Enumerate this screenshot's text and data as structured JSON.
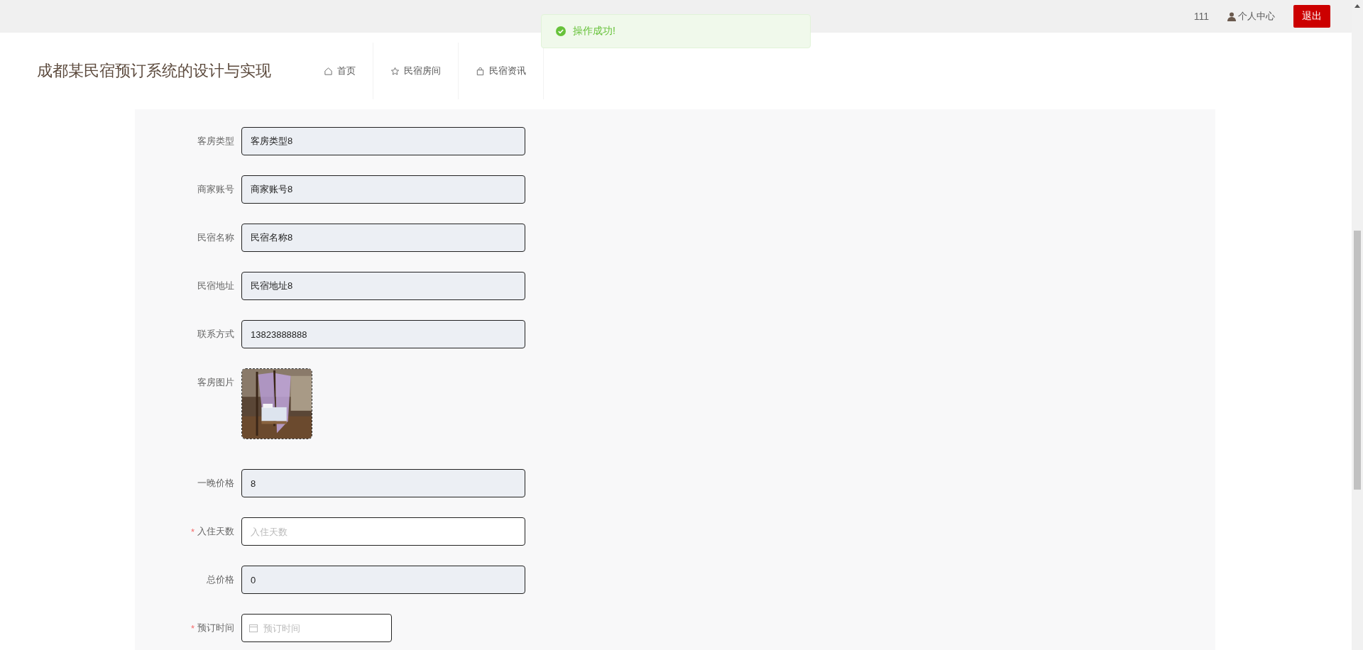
{
  "top_bar": {
    "username": "111",
    "profile_link": "个人中心",
    "logout_button": "退出"
  },
  "toast": {
    "message": "操作成功!"
  },
  "header": {
    "title": "成都某民宿预订系统的设计与实现",
    "nav": [
      {
        "label": "首页",
        "selected": false
      },
      {
        "label": "民宿房间",
        "selected": false
      },
      {
        "label": "民宿资讯",
        "selected": false
      }
    ]
  },
  "form": {
    "fields": [
      {
        "kind": "text",
        "label": "客房类型",
        "value": "客房类型8",
        "readonly": true
      },
      {
        "kind": "text",
        "label": "商家账号",
        "value": "商家账号8",
        "readonly": true
      },
      {
        "kind": "text",
        "label": "民宿名称",
        "value": "民宿名称8",
        "readonly": true
      },
      {
        "kind": "text",
        "label": "民宿地址",
        "value": "民宿地址8",
        "readonly": true
      },
      {
        "kind": "text",
        "label": "联系方式",
        "value": "13823888888",
        "readonly": true
      },
      {
        "label": "客房图片"
      },
      {
        "kind": "text",
        "label": "一晚价格",
        "value": "8",
        "readonly": true
      },
      {
        "kind": "text",
        "label": "入住天数",
        "required_mark": "*",
        "placeholder": "入住天数",
        "readonly": false
      },
      {
        "kind": "text",
        "label": "总价格",
        "value": "0",
        "readonly": true
      },
      {
        "kind": "date",
        "label": "预订时间",
        "required_mark": "*",
        "placeholder": "预订时间",
        "readonly": false
      }
    ]
  }
}
